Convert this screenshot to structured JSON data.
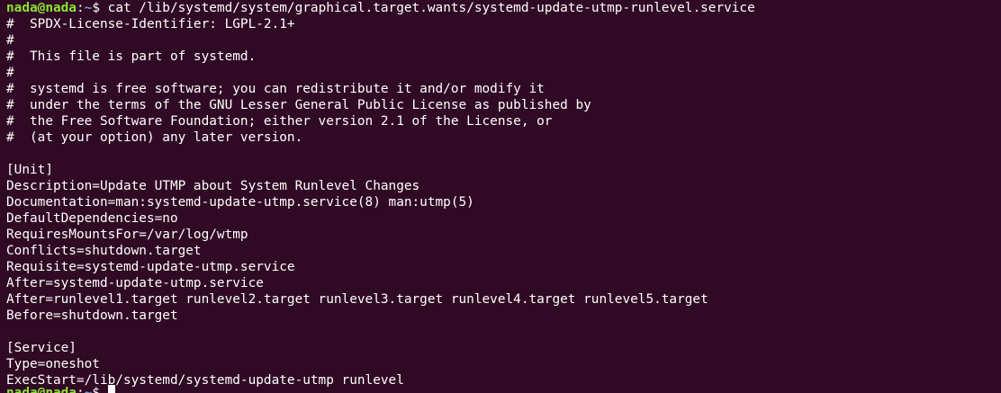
{
  "prompt": {
    "user_host": "nada@nada",
    "separator": ":",
    "path": "~",
    "symbol": "$ "
  },
  "command": "cat /lib/systemd/system/graphical.target.wants/systemd-update-utmp-runlevel.service",
  "output_lines": [
    "#  SPDX-License-Identifier: LGPL-2.1+",
    "#",
    "#  This file is part of systemd.",
    "#",
    "#  systemd is free software; you can redistribute it and/or modify it",
    "#  under the terms of the GNU Lesser General Public License as published by",
    "#  the Free Software Foundation; either version 2.1 of the License, or",
    "#  (at your option) any later version.",
    "",
    "[Unit]",
    "Description=Update UTMP about System Runlevel Changes",
    "Documentation=man:systemd-update-utmp.service(8) man:utmp(5)",
    "DefaultDependencies=no",
    "RequiresMountsFor=/var/log/wtmp",
    "Conflicts=shutdown.target",
    "Requisite=systemd-update-utmp.service",
    "After=systemd-update-utmp.service",
    "After=runlevel1.target runlevel2.target runlevel3.target runlevel4.target runlevel5.target",
    "Before=shutdown.target",
    "",
    "[Service]",
    "Type=oneshot",
    "ExecStart=/lib/systemd/systemd-update-utmp runlevel"
  ],
  "final_prompt": {
    "user_host": "nada@nada",
    "separator": ":",
    "path": "~",
    "symbol": "$ "
  }
}
